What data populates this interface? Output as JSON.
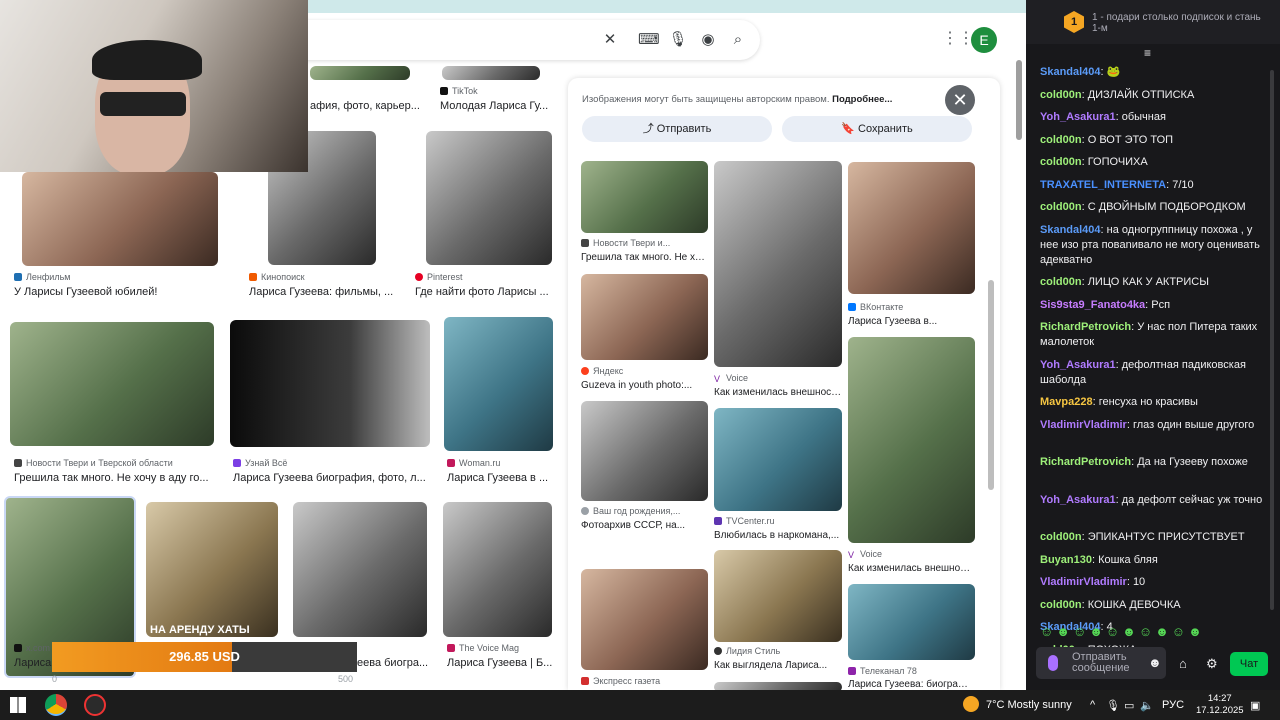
{
  "browser": {
    "left_grid": [
      {
        "source": "TikTok",
        "title": "Молодая Лариса Гу..."
      },
      {
        "source": "",
        "title": "афия, фото, карьер..."
      },
      {
        "source": "Ленфильм",
        "title": "У Ларисы Гузеевой юбилей!"
      },
      {
        "source": "Кинопоиск",
        "title": "Лариса Гузеева: фильмы, ..."
      },
      {
        "source": "Pinterest",
        "title": "Где найти фото Ларисы ..."
      },
      {
        "source": "Новости Твери и Тверской области",
        "title": "Грешила так много. Не хочу в аду го..."
      },
      {
        "source": "Узнай Всё",
        "title": "Лариса Гузеева биография, фото, л..."
      },
      {
        "source": "Woman.ru",
        "title": "Лариса Гузеева в ..."
      },
      {
        "source": "x.com",
        "title": "Лариса"
      },
      {
        "source": "",
        "title": "еева биогра..."
      },
      {
        "source": "The Voice Mag",
        "title": "Лариса Гузеева | Б..."
      },
      {
        "overlay": "НА АРЕНДУ ХАТЫ"
      }
    ],
    "panel": {
      "note": "Изображения могут быть защищены авторским правом.",
      "note_link": "Подробнее...",
      "share_label": "Отправить",
      "save_label": "Сохранить",
      "close_glyph": "✕",
      "results": [
        {
          "source": "Новости Твери и...",
          "title": "Грешила так много. Не хочу..."
        },
        {
          "source": "Яндекс",
          "title": "Guzeva in youth photo:..."
        },
        {
          "source": "Ваш год рождения,...",
          "title": "Фотоархив СССР, на..."
        },
        {
          "source": "Экспресс газета",
          "title": ""
        },
        {
          "source": "Voice",
          "title": "Как изменилась внешност..."
        },
        {
          "source": "TVCenter.ru",
          "title": "Влюбилась в наркомана,..."
        },
        {
          "source": "Лидия Стиль",
          "title": "Как выглядела Лариса..."
        },
        {
          "source": "ВКонтакте",
          "title": "Лариса Гузеева в..."
        },
        {
          "source": "Voice",
          "title": "Как изменилась внешност..."
        },
        {
          "source": "Телеканал 78",
          "title": "Лариса Гузеева: биографи..."
        }
      ]
    }
  },
  "overlay": {
    "donation_amount": "296.85 USD",
    "progress_end_label": "500",
    "progress_start_label": "0",
    "progress_fraction": 0.59
  },
  "chat": {
    "pinned": {
      "rank": "1",
      "text": "1 - подари столько подписок и стань 1-м"
    },
    "messages": [
      {
        "user": "Skandal404",
        "color": "#5b9bf8",
        "text": "🐸"
      },
      {
        "user": "cold00n",
        "color": "#9ef07a",
        "text": "ДИЗЛАЙК ОТПИСКА"
      },
      {
        "user": "Yoh_Asakura1",
        "color": "#b07bff",
        "text": "обычная"
      },
      {
        "user": "cold00n",
        "color": "#9ef07a",
        "text": "О ВОТ ЭТО ТОП"
      },
      {
        "user": "cold00n",
        "color": "#9ef07a",
        "text": "ГОПОЧИХА"
      },
      {
        "user": "TRAXATEL_INTERNETA",
        "color": "#4a90ff",
        "text": "7/10"
      },
      {
        "user": "cold00n",
        "color": "#9ef07a",
        "text": "С ДВОЙНЫМ ПОДБОРОДКОМ"
      },
      {
        "user": "Skandal404",
        "color": "#5b9bf8",
        "text": "на одногруппницу похожа , у нее изо рта повanивало не могу оценивать адекватно"
      },
      {
        "user": "cold00n",
        "color": "#9ef07a",
        "text": "ЛИЦО КАК У АКТРИСЫ"
      },
      {
        "user": "Sis9sta9_Fanato4ka",
        "color": "#c77dff",
        "text": "Рсп"
      },
      {
        "user": "RichardPetrovich",
        "color": "#9ef07a",
        "text": "У нас пол Питера таких малолеток"
      },
      {
        "user": "Yoh_Asakura1",
        "color": "#b07bff",
        "text": "дефолтная падиковская шаболда"
      },
      {
        "user": "Mavpa228",
        "color": "#f5c542",
        "text": "генсуха но красивы"
      },
      {
        "user": "VladimirVladimir",
        "color": "#b07bff",
        "text": "глаз один выше другого"
      },
      {
        "user": "RichardPetrovich",
        "color": "#9ef07a",
        "text": "Да на Гузееву похоже"
      },
      {
        "user": "Yoh_Asakura1",
        "color": "#b07bff",
        "text": "да дефолт сейчас уж точно"
      },
      {
        "user": "cold00n",
        "color": "#9ef07a",
        "text": "ЭПИКАНТУС ПРИСУТСТВУЕТ"
      },
      {
        "user": "Buyan130",
        "color": "#9ef07a",
        "text": "Кошка бляя"
      },
      {
        "user": "VladimirVladimir",
        "color": "#b07bff",
        "text": "10"
      },
      {
        "user": "cold00n",
        "color": "#9ef07a",
        "text": "КОШКА ДЕВОЧКА"
      },
      {
        "user": "Skandal404",
        "color": "#5b9bf8",
        "text": "4"
      },
      {
        "user": "cold00n",
        "color": "#9ef07a",
        "text": "ПОХОЖА"
      }
    ],
    "input_placeholder": "Отправить сообщение",
    "chat_button": "Чат"
  },
  "taskbar": {
    "weather": "7°C Mostly sunny",
    "lang": "РУС",
    "time": "14:27",
    "date": "17.12.2025"
  }
}
